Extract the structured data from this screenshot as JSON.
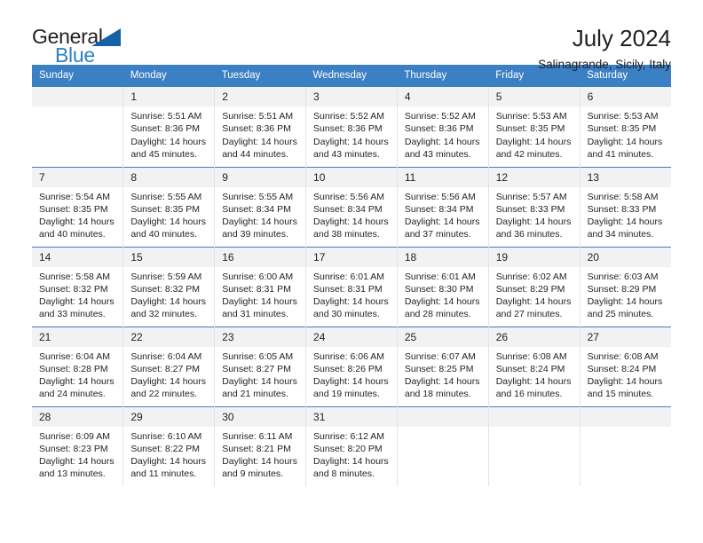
{
  "brand": {
    "name_part1": "General",
    "name_part2": "Blue",
    "triangle_color": "#1461a6",
    "blue_color": "#2f7fc4"
  },
  "header": {
    "title": "July 2024",
    "subtitle": "Salinagrande, Sicily, Italy"
  },
  "theme": {
    "header_blue": "#3b7fc4",
    "daynum_band": "#f2f2f2",
    "grid_line": "#e3e3e3",
    "text": "#231f20"
  },
  "weekday_headers": [
    "Sunday",
    "Monday",
    "Tuesday",
    "Wednesday",
    "Thursday",
    "Friday",
    "Saturday"
  ],
  "weeks": [
    [
      {
        "day": "",
        "empty": true,
        "sunrise": "",
        "sunset": "",
        "daylight_line1": "",
        "daylight_line2": ""
      },
      {
        "day": "1",
        "sunrise": "Sunrise: 5:51 AM",
        "sunset": "Sunset: 8:36 PM",
        "daylight_line1": "Daylight: 14 hours",
        "daylight_line2": "and 45 minutes."
      },
      {
        "day": "2",
        "sunrise": "Sunrise: 5:51 AM",
        "sunset": "Sunset: 8:36 PM",
        "daylight_line1": "Daylight: 14 hours",
        "daylight_line2": "and 44 minutes."
      },
      {
        "day": "3",
        "sunrise": "Sunrise: 5:52 AM",
        "sunset": "Sunset: 8:36 PM",
        "daylight_line1": "Daylight: 14 hours",
        "daylight_line2": "and 43 minutes."
      },
      {
        "day": "4",
        "sunrise": "Sunrise: 5:52 AM",
        "sunset": "Sunset: 8:36 PM",
        "daylight_line1": "Daylight: 14 hours",
        "daylight_line2": "and 43 minutes."
      },
      {
        "day": "5",
        "sunrise": "Sunrise: 5:53 AM",
        "sunset": "Sunset: 8:35 PM",
        "daylight_line1": "Daylight: 14 hours",
        "daylight_line2": "and 42 minutes."
      },
      {
        "day": "6",
        "sunrise": "Sunrise: 5:53 AM",
        "sunset": "Sunset: 8:35 PM",
        "daylight_line1": "Daylight: 14 hours",
        "daylight_line2": "and 41 minutes."
      }
    ],
    [
      {
        "day": "7",
        "sunrise": "Sunrise: 5:54 AM",
        "sunset": "Sunset: 8:35 PM",
        "daylight_line1": "Daylight: 14 hours",
        "daylight_line2": "and 40 minutes."
      },
      {
        "day": "8",
        "sunrise": "Sunrise: 5:55 AM",
        "sunset": "Sunset: 8:35 PM",
        "daylight_line1": "Daylight: 14 hours",
        "daylight_line2": "and 40 minutes."
      },
      {
        "day": "9",
        "sunrise": "Sunrise: 5:55 AM",
        "sunset": "Sunset: 8:34 PM",
        "daylight_line1": "Daylight: 14 hours",
        "daylight_line2": "and 39 minutes."
      },
      {
        "day": "10",
        "sunrise": "Sunrise: 5:56 AM",
        "sunset": "Sunset: 8:34 PM",
        "daylight_line1": "Daylight: 14 hours",
        "daylight_line2": "and 38 minutes."
      },
      {
        "day": "11",
        "sunrise": "Sunrise: 5:56 AM",
        "sunset": "Sunset: 8:34 PM",
        "daylight_line1": "Daylight: 14 hours",
        "daylight_line2": "and 37 minutes."
      },
      {
        "day": "12",
        "sunrise": "Sunrise: 5:57 AM",
        "sunset": "Sunset: 8:33 PM",
        "daylight_line1": "Daylight: 14 hours",
        "daylight_line2": "and 36 minutes."
      },
      {
        "day": "13",
        "sunrise": "Sunrise: 5:58 AM",
        "sunset": "Sunset: 8:33 PM",
        "daylight_line1": "Daylight: 14 hours",
        "daylight_line2": "and 34 minutes."
      }
    ],
    [
      {
        "day": "14",
        "sunrise": "Sunrise: 5:58 AM",
        "sunset": "Sunset: 8:32 PM",
        "daylight_line1": "Daylight: 14 hours",
        "daylight_line2": "and 33 minutes."
      },
      {
        "day": "15",
        "sunrise": "Sunrise: 5:59 AM",
        "sunset": "Sunset: 8:32 PM",
        "daylight_line1": "Daylight: 14 hours",
        "daylight_line2": "and 32 minutes."
      },
      {
        "day": "16",
        "sunrise": "Sunrise: 6:00 AM",
        "sunset": "Sunset: 8:31 PM",
        "daylight_line1": "Daylight: 14 hours",
        "daylight_line2": "and 31 minutes."
      },
      {
        "day": "17",
        "sunrise": "Sunrise: 6:01 AM",
        "sunset": "Sunset: 8:31 PM",
        "daylight_line1": "Daylight: 14 hours",
        "daylight_line2": "and 30 minutes."
      },
      {
        "day": "18",
        "sunrise": "Sunrise: 6:01 AM",
        "sunset": "Sunset: 8:30 PM",
        "daylight_line1": "Daylight: 14 hours",
        "daylight_line2": "and 28 minutes."
      },
      {
        "day": "19",
        "sunrise": "Sunrise: 6:02 AM",
        "sunset": "Sunset: 8:29 PM",
        "daylight_line1": "Daylight: 14 hours",
        "daylight_line2": "and 27 minutes."
      },
      {
        "day": "20",
        "sunrise": "Sunrise: 6:03 AM",
        "sunset": "Sunset: 8:29 PM",
        "daylight_line1": "Daylight: 14 hours",
        "daylight_line2": "and 25 minutes."
      }
    ],
    [
      {
        "day": "21",
        "sunrise": "Sunrise: 6:04 AM",
        "sunset": "Sunset: 8:28 PM",
        "daylight_line1": "Daylight: 14 hours",
        "daylight_line2": "and 24 minutes."
      },
      {
        "day": "22",
        "sunrise": "Sunrise: 6:04 AM",
        "sunset": "Sunset: 8:27 PM",
        "daylight_line1": "Daylight: 14 hours",
        "daylight_line2": "and 22 minutes."
      },
      {
        "day": "23",
        "sunrise": "Sunrise: 6:05 AM",
        "sunset": "Sunset: 8:27 PM",
        "daylight_line1": "Daylight: 14 hours",
        "daylight_line2": "and 21 minutes."
      },
      {
        "day": "24",
        "sunrise": "Sunrise: 6:06 AM",
        "sunset": "Sunset: 8:26 PM",
        "daylight_line1": "Daylight: 14 hours",
        "daylight_line2": "and 19 minutes."
      },
      {
        "day": "25",
        "sunrise": "Sunrise: 6:07 AM",
        "sunset": "Sunset: 8:25 PM",
        "daylight_line1": "Daylight: 14 hours",
        "daylight_line2": "and 18 minutes."
      },
      {
        "day": "26",
        "sunrise": "Sunrise: 6:08 AM",
        "sunset": "Sunset: 8:24 PM",
        "daylight_line1": "Daylight: 14 hours",
        "daylight_line2": "and 16 minutes."
      },
      {
        "day": "27",
        "sunrise": "Sunrise: 6:08 AM",
        "sunset": "Sunset: 8:24 PM",
        "daylight_line1": "Daylight: 14 hours",
        "daylight_line2": "and 15 minutes."
      }
    ],
    [
      {
        "day": "28",
        "sunrise": "Sunrise: 6:09 AM",
        "sunset": "Sunset: 8:23 PM",
        "daylight_line1": "Daylight: 14 hours",
        "daylight_line2": "and 13 minutes."
      },
      {
        "day": "29",
        "sunrise": "Sunrise: 6:10 AM",
        "sunset": "Sunset: 8:22 PM",
        "daylight_line1": "Daylight: 14 hours",
        "daylight_line2": "and 11 minutes."
      },
      {
        "day": "30",
        "sunrise": "Sunrise: 6:11 AM",
        "sunset": "Sunset: 8:21 PM",
        "daylight_line1": "Daylight: 14 hours",
        "daylight_line2": "and 9 minutes."
      },
      {
        "day": "31",
        "sunrise": "Sunrise: 6:12 AM",
        "sunset": "Sunset: 8:20 PM",
        "daylight_line1": "Daylight: 14 hours",
        "daylight_line2": "and 8 minutes."
      },
      {
        "day": "",
        "empty": true,
        "sunrise": "",
        "sunset": "",
        "daylight_line1": "",
        "daylight_line2": ""
      },
      {
        "day": "",
        "empty": true,
        "sunrise": "",
        "sunset": "",
        "daylight_line1": "",
        "daylight_line2": ""
      },
      {
        "day": "",
        "empty": true,
        "sunrise": "",
        "sunset": "",
        "daylight_line1": "",
        "daylight_line2": ""
      }
    ]
  ]
}
